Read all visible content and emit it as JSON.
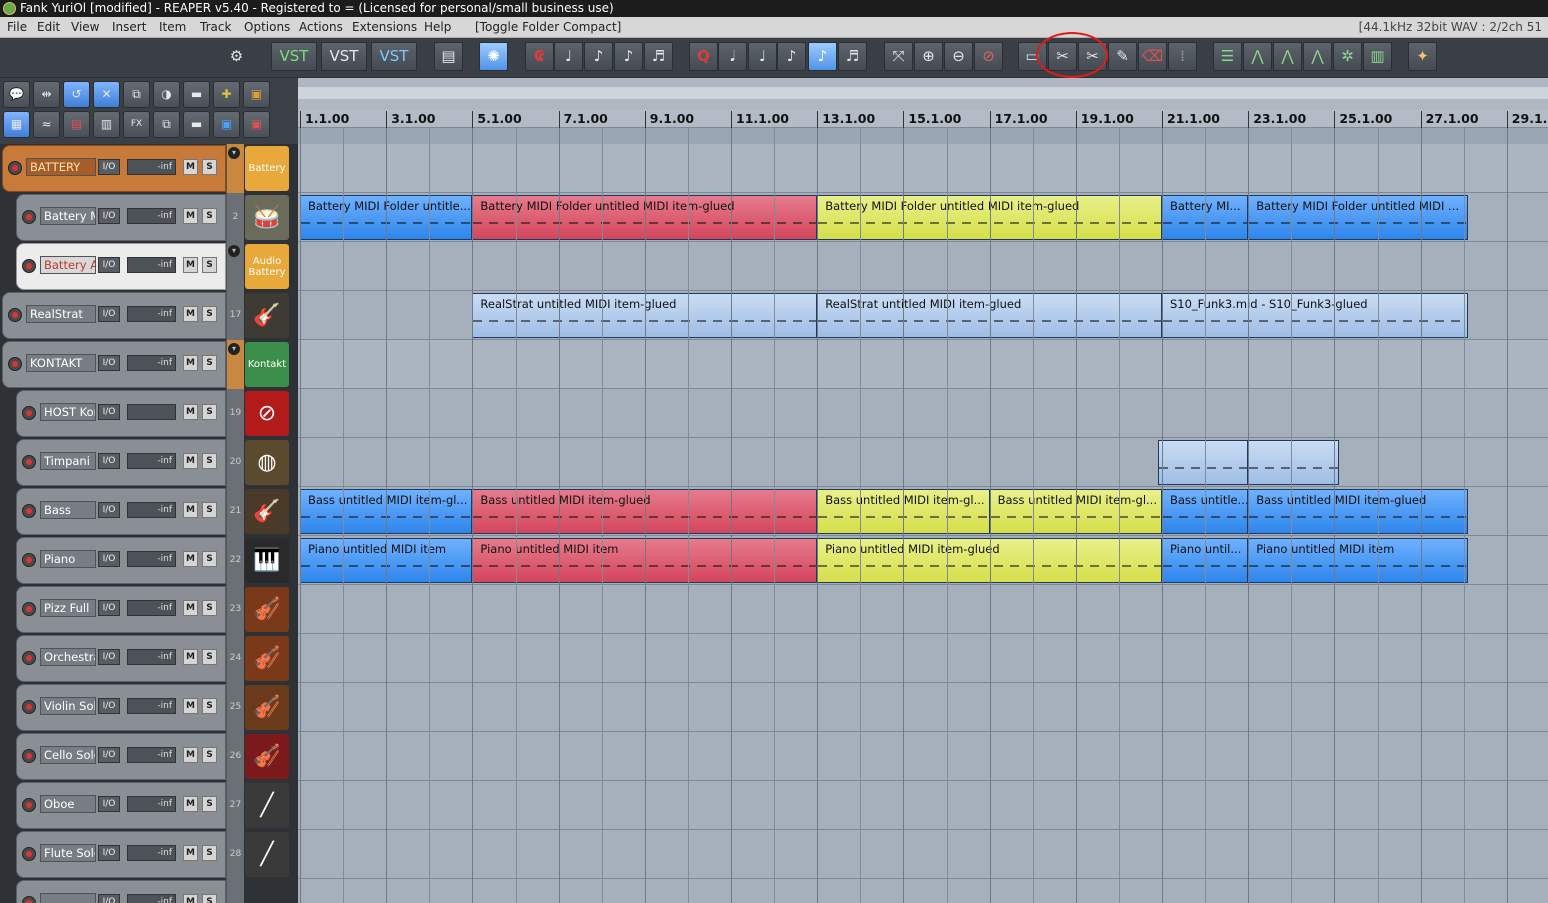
{
  "window": {
    "title": "Fank YuriOl [modified] - REAPER v5.40 - Registered to = (Licensed for personal/small business use)"
  },
  "menu": {
    "items": [
      "File",
      "Edit",
      "View",
      "Insert",
      "Item",
      "Track",
      "Options",
      "Actions",
      "Extensions",
      "Help",
      "[Toggle Folder Compact]"
    ],
    "status": "[44.1kHz 32bit WAV : 2/2ch 51"
  },
  "toolbar": {
    "vst_labels": [
      "VST",
      "VST",
      "VST"
    ],
    "quantize_label": "Q",
    "icons": [
      "settings-icon",
      "vst-plugin-icon",
      "vst-plugin-icon",
      "vst-plugin-icon",
      "clapper-icon",
      "metronome-figure-icon",
      "record-icon",
      "note-icon",
      "eighth-note-icon",
      "eighth-note-icon",
      "sixteenth-note-icon",
      "quantize-icon",
      "note-grid-icon",
      "note-grid-icon",
      "note-grid-icon",
      "note-grid-icon",
      "note-grid-active-icon",
      "note-grid-icon",
      "zoom-fit-icon",
      "zoom-in-icon",
      "zoom-out-icon",
      "zoom-reset-icon",
      "glue-icon",
      "split-icon",
      "cut-icon",
      "pencil-icon",
      "eraser-icon",
      "marker-icon",
      "mixer-icon",
      "envelope-icon",
      "envelope-icon",
      "envelope-icon",
      "routing-icon",
      "meter-icon",
      "palette-icon"
    ]
  },
  "tcp_toolbar": {
    "fx_label": "FX"
  },
  "tracks": [
    {
      "name": "BATTERY",
      "num": "",
      "volume": "-inf",
      "type": "folder",
      "icon": "Battery",
      "icon_color": "#e8a93a",
      "indent": 0
    },
    {
      "name": "Battery MII",
      "num": "2",
      "volume": "-inf",
      "type": "child",
      "icon": "drums",
      "icon_color": "#6b6b5c",
      "indent": 1
    },
    {
      "name": "Battery AU",
      "num": "",
      "volume": "-inf",
      "type": "selected",
      "icon": "Audio Battery",
      "icon_color": "#e8a93a",
      "indent": 1
    },
    {
      "name": "RealStrat",
      "num": "17",
      "volume": "-inf",
      "type": "normal",
      "icon": "guitar",
      "icon_color": "#3e3a34",
      "indent": 0
    },
    {
      "name": "KONTAKT",
      "num": "",
      "volume": "-inf",
      "type": "folder2",
      "icon": "Kontakt",
      "icon_color": "#3c8f4a",
      "indent": 0
    },
    {
      "name": "HOST Kon",
      "num": "19",
      "volume": "",
      "type": "child",
      "icon": "host",
      "icon_color": "#b31b1b",
      "indent": 1
    },
    {
      "name": "Timpani",
      "num": "20",
      "volume": "-inf",
      "type": "child",
      "icon": "timpani",
      "icon_color": "#5b4a2e",
      "indent": 1
    },
    {
      "name": "Bass",
      "num": "21",
      "volume": "-inf",
      "type": "child",
      "icon": "bass",
      "icon_color": "#4a3a2a",
      "indent": 1
    },
    {
      "name": "Piano",
      "num": "22",
      "volume": "-inf",
      "type": "child",
      "icon": "piano",
      "icon_color": "#2a2a2a",
      "indent": 1
    },
    {
      "name": "Pizz Full",
      "num": "23",
      "volume": "-inf",
      "type": "child",
      "icon": "strings",
      "icon_color": "#7a3a1a",
      "indent": 1
    },
    {
      "name": "Orchestral",
      "num": "24",
      "volume": "-inf",
      "type": "child",
      "icon": "strings",
      "icon_color": "#7a3a1a",
      "indent": 1
    },
    {
      "name": "Violin Solo",
      "num": "25",
      "volume": "-inf",
      "type": "child",
      "icon": "violin",
      "icon_color": "#6a3a1a",
      "indent": 1
    },
    {
      "name": "Cello Solo",
      "num": "26",
      "volume": "-inf",
      "type": "child",
      "icon": "cello",
      "icon_color": "#7a1a1a",
      "indent": 1
    },
    {
      "name": "Oboe",
      "num": "27",
      "volume": "-inf",
      "type": "child",
      "icon": "oboe",
      "icon_color": "#3a3a3a",
      "indent": 1
    },
    {
      "name": "Flute Solo",
      "num": "28",
      "volume": "-inf",
      "type": "child",
      "icon": "flute",
      "icon_color": "#3a3a3a",
      "indent": 1
    },
    {
      "name": "",
      "num": "",
      "volume": "-inf",
      "type": "child",
      "icon": "",
      "icon_color": "#3a3a3a",
      "indent": 1
    }
  ],
  "ruler": {
    "labels": [
      "1.1.00",
      "3.1.00",
      "5.1.00",
      "7.1.00",
      "9.1.00",
      "11.1.00",
      "13.1.00",
      "15.1.00",
      "17.1.00",
      "19.1.00",
      "21.1.00",
      "23.1.00",
      "25.1.00",
      "27.1.00",
      "29.1."
    ]
  },
  "items": [
    {
      "lane": 1,
      "label": "Battery MIDI Folder untitle...",
      "color": "blue",
      "start": 0,
      "end": 4
    },
    {
      "lane": 1,
      "label": "Battery MIDI Folder untitled MIDI item-glued",
      "color": "red",
      "start": 4,
      "end": 12
    },
    {
      "lane": 1,
      "label": "Battery MIDI Folder untitled MIDI item-glued",
      "color": "yellow",
      "start": 12,
      "end": 20
    },
    {
      "lane": 1,
      "label": "Battery MI...",
      "color": "blue",
      "start": 20,
      "end": 22
    },
    {
      "lane": 1,
      "label": "Battery MIDI Folder untitled MIDI ...",
      "color": "blue",
      "start": 22,
      "end": 27.1
    },
    {
      "lane": 3,
      "label": "RealStrat untitled MIDI item-glued",
      "color": "pale",
      "start": 4,
      "end": 12
    },
    {
      "lane": 3,
      "label": "RealStrat untitled MIDI item-glued",
      "color": "pale",
      "start": 12,
      "end": 20
    },
    {
      "lane": 3,
      "label": "S10_Funk3.mid - S10_Funk3-glued",
      "color": "pale",
      "start": 20,
      "end": 27.1
    },
    {
      "lane": 6,
      "label": "",
      "color": "pale",
      "start": 19.9,
      "end": 22
    },
    {
      "lane": 6,
      "label": "",
      "color": "pale",
      "start": 22,
      "end": 24.1
    },
    {
      "lane": 7,
      "label": "Bass untitled MIDI item-gl...",
      "color": "blue",
      "start": 0,
      "end": 4
    },
    {
      "lane": 7,
      "label": "Bass untitled MIDI item-glued",
      "color": "red",
      "start": 4,
      "end": 12
    },
    {
      "lane": 7,
      "label": "Bass untitled MIDI item-gl...",
      "color": "yellow",
      "start": 12,
      "end": 16
    },
    {
      "lane": 7,
      "label": "Bass untitled MIDI item-gl...",
      "color": "yellow",
      "start": 16,
      "end": 20
    },
    {
      "lane": 7,
      "label": "Bass untitle...",
      "color": "blue",
      "start": 20,
      "end": 22
    },
    {
      "lane": 7,
      "label": "Bass untitled MIDI item-glued",
      "color": "blue",
      "start": 22,
      "end": 27.1
    },
    {
      "lane": 8,
      "label": "Piano untitled MIDI item",
      "color": "blue",
      "start": 0,
      "end": 4
    },
    {
      "lane": 8,
      "label": "Piano untitled MIDI item",
      "color": "red",
      "start": 4,
      "end": 12
    },
    {
      "lane": 8,
      "label": "Piano untitled MIDI item-glued",
      "color": "yellow",
      "start": 12,
      "end": 20
    },
    {
      "lane": 8,
      "label": "Piano until...",
      "color": "blue",
      "start": 20,
      "end": 22
    },
    {
      "lane": 8,
      "label": "Piano untitled MIDI item",
      "color": "blue",
      "start": 22,
      "end": 27.1
    }
  ],
  "colors": {
    "blue": "#3d8fef",
    "red": "#d94f65",
    "yellow": "#dfe65c",
    "pale": "#b6cdec",
    "annotation": "#e11a1a"
  }
}
